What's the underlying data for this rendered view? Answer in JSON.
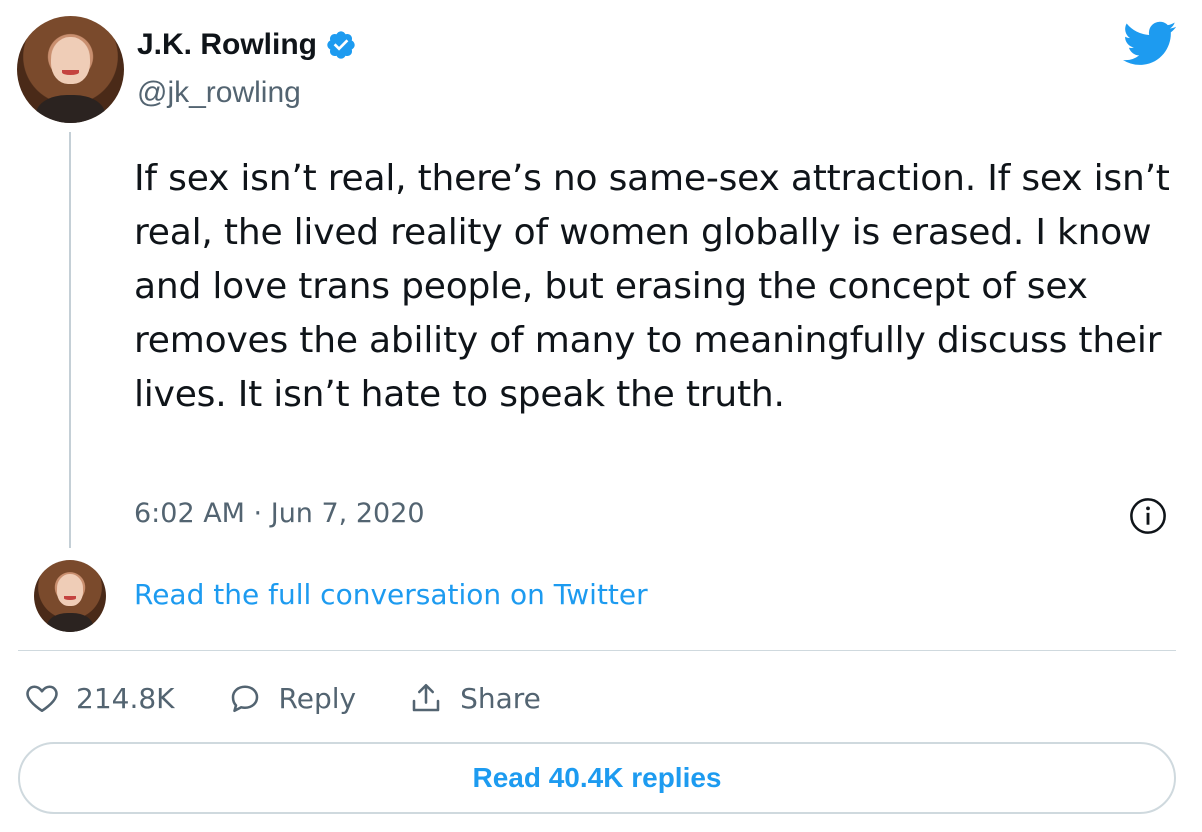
{
  "author": {
    "display_name": "J.K. Rowling",
    "handle": "@jk_rowling",
    "verified": true
  },
  "tweet": {
    "text": "If sex isn’t real, there’s no same-sex attraction. If sex isn’t real, the lived reality of women globally is erased. I know and love trans people, but erasing the concept of sex removes the ability of many to meaningfully discuss their lives. It isn’t hate to speak the truth.",
    "timestamp": "6:02 AM · Jun 7, 2020"
  },
  "links": {
    "read_full_conversation": "Read the full conversation on Twitter"
  },
  "actions": {
    "like_count": "214.8K",
    "reply_label": "Reply",
    "share_label": "Share"
  },
  "footer": {
    "read_replies_label": "Read 40.4K replies"
  },
  "icons": {
    "brand": "twitter-bird-icon",
    "verified": "verified-badge-icon",
    "info": "info-icon",
    "like": "heart-icon",
    "reply": "speech-bubble-icon",
    "share": "share-upload-icon"
  },
  "colors": {
    "accent": "#1d9bf0",
    "text_primary": "#0f1419",
    "text_secondary": "#536471",
    "border": "#cfd9de"
  }
}
